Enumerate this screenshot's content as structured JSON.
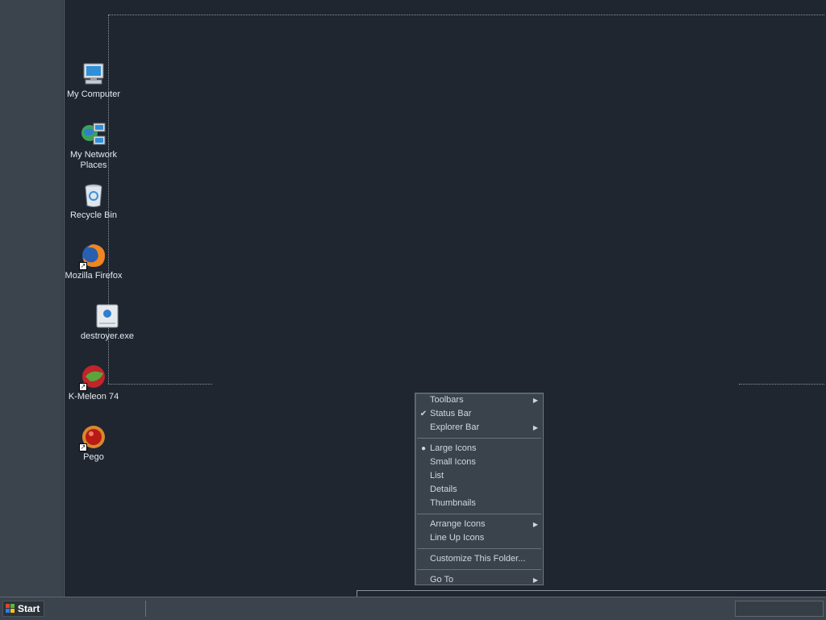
{
  "desktop_icons": [
    {
      "label": "My Computer",
      "icon": "my-computer-icon",
      "shortcut": false
    },
    {
      "label": "My Network Places",
      "icon": "network-places-icon",
      "shortcut": false
    },
    {
      "label": "Recycle Bin",
      "icon": "recycle-bin-icon",
      "shortcut": false
    },
    {
      "label": "Mozilla Firefox",
      "icon": "firefox-icon",
      "shortcut": true
    },
    {
      "label": "destroyer.exe",
      "icon": "exe-icon",
      "shortcut": false
    },
    {
      "label": "K-Meleon 74",
      "icon": "k-meleon-icon",
      "shortcut": true
    },
    {
      "label": "Pego",
      "icon": "pego-icon",
      "shortcut": true
    }
  ],
  "context_menu": {
    "toolbars": "Toolbars",
    "status_bar": "Status Bar",
    "explorer_bar": "Explorer Bar",
    "large_icons": "Large Icons",
    "small_icons": "Small Icons",
    "list": "List",
    "details": "Details",
    "thumbnails": "Thumbnails",
    "arrange_icons": "Arrange Icons",
    "line_up_icons": "Line Up Icons",
    "customize": "Customize This Folder...",
    "go_to": "Go To"
  },
  "taskbar": {
    "start_label": "Start"
  },
  "colors": {
    "desktop": "#1f2630",
    "panel": "#3b444d",
    "menu": "#3a434c",
    "text": "#cfd6de"
  }
}
